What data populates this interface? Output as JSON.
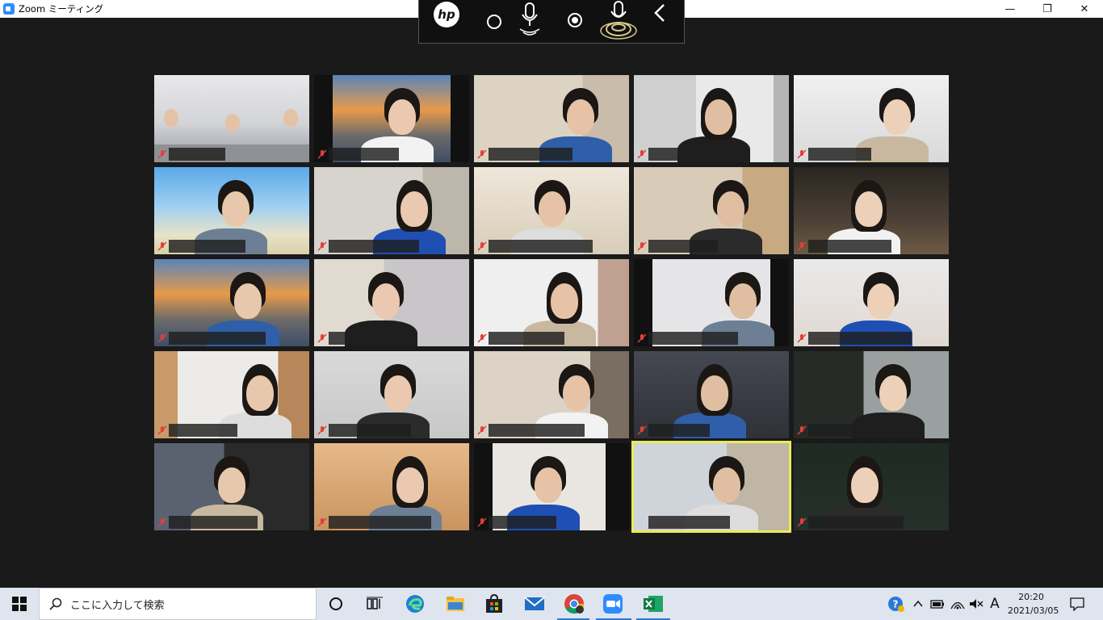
{
  "window": {
    "title": "Zoom ミーティング",
    "minimize": "—",
    "restore": "❐",
    "close": "✕"
  },
  "overlay": {
    "logo": "hp"
  },
  "taskbar": {
    "search_placeholder": "ここに入力して検索",
    "ime_indicator": "A",
    "time": "20:20",
    "date": "2021/03/05"
  },
  "colors": {
    "active_speaker_border": "#e8ec5a",
    "muted_mic": "#e0413a",
    "zoom_blue": "#2d8cff"
  },
  "participants": [
    {
      "muted": true
    },
    {
      "muted": true
    },
    {
      "muted": true
    },
    {
      "muted": true
    },
    {
      "muted": true
    },
    {
      "muted": true
    },
    {
      "muted": true
    },
    {
      "muted": true
    },
    {
      "muted": true
    },
    {
      "muted": true
    },
    {
      "muted": true
    },
    {
      "muted": true
    },
    {
      "muted": true
    },
    {
      "muted": true
    },
    {
      "muted": true
    },
    {
      "muted": true
    },
    {
      "muted": true
    },
    {
      "muted": true
    },
    {
      "muted": true
    },
    {
      "muted": true
    },
    {
      "muted": true
    },
    {
      "muted": true
    },
    {
      "muted": true
    },
    {
      "muted": false,
      "active_speaker": true
    },
    {
      "muted": true
    }
  ]
}
